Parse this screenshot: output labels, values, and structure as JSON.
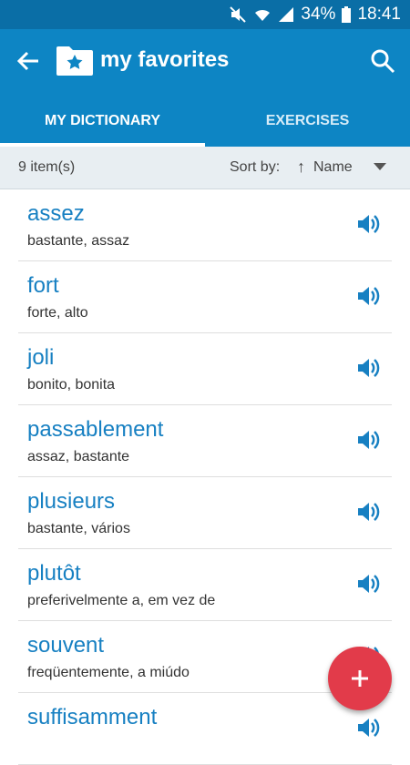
{
  "statusbar": {
    "battery": "34%",
    "time": "18:41"
  },
  "appbar": {
    "title": "my favorites"
  },
  "tabs": [
    {
      "label": "MY DICTIONARY"
    },
    {
      "label": "EXERCISES"
    }
  ],
  "sortbar": {
    "count": "9 item(s)",
    "sort_label": "Sort by:",
    "sort_value": "Name"
  },
  "items": [
    {
      "word": "assez",
      "translation": "bastante, assaz"
    },
    {
      "word": "fort",
      "translation": "forte, alto"
    },
    {
      "word": "joli",
      "translation": "bonito, bonita"
    },
    {
      "word": "passablement",
      "translation": "assaz, bastante"
    },
    {
      "word": "plusieurs",
      "translation": "bastante, vários"
    },
    {
      "word": "plutôt",
      "translation": "preferivelmente a, em vez de"
    },
    {
      "word": "souvent",
      "translation": "freqüentemente, a miúdo"
    },
    {
      "word": "suffisamment",
      "translation": ""
    }
  ],
  "colors": {
    "appbar": "#0d85c4",
    "statusbar": "#0a6ea6",
    "accent": "#1780c2",
    "fab": "#e23b4a"
  }
}
